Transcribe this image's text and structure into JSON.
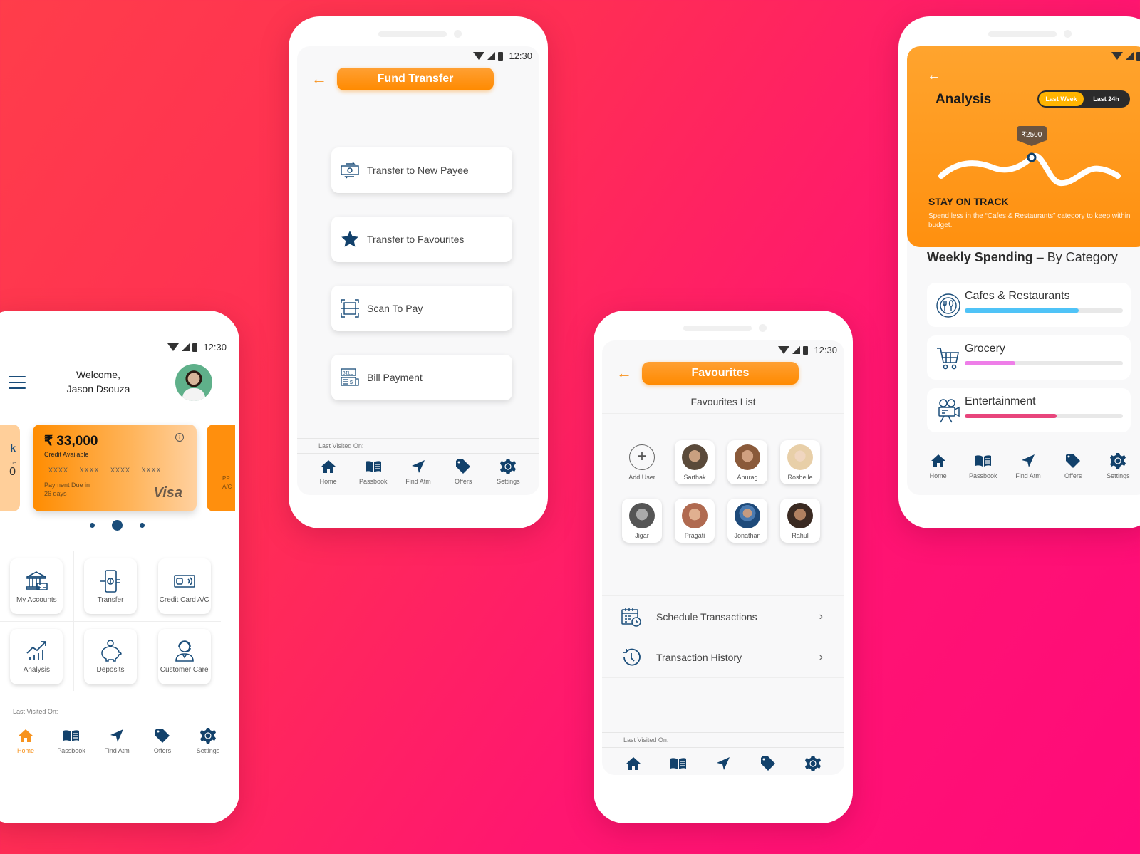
{
  "colors": {
    "accent": "#ff8c00",
    "navy": "#12416b",
    "bg_start": "#ff3d4a",
    "bg_end": "#ff0a7a"
  },
  "status_bar": {
    "time": "12:30",
    "icons": [
      "wifi-icon",
      "signal-icon",
      "battery-icon"
    ]
  },
  "bottom_nav": {
    "items": [
      {
        "label": "Home",
        "icon": "home-icon"
      },
      {
        "label": "Passbook",
        "icon": "passbook-icon"
      },
      {
        "label": "Find Atm",
        "icon": "navigation-arrow-icon"
      },
      {
        "label": "Offers",
        "icon": "tag-icon"
      },
      {
        "label": "Settings",
        "icon": "gear-icon"
      }
    ]
  },
  "last_visited_label": "Last Visited On:",
  "home": {
    "welcome_line1": "Welcome,",
    "welcome_line2": "Jason Dsouza",
    "active_nav": "Home",
    "card_left": {
      "fragment1": "k",
      "fragment2": "ce",
      "fragment3": "0"
    },
    "card": {
      "amount": "₹ 33,000",
      "amount_label": "Credit Available",
      "number": "XXXX XXXX XXXX XXXX",
      "due_line1": "Payment Due in",
      "due_line2": "26 days",
      "brand": "Visa",
      "info_icon": "info-icon"
    },
    "card_right": {
      "line1": "PP",
      "line2": "A/C"
    },
    "carousel": {
      "count": 3,
      "active": 2
    },
    "tiles": [
      {
        "label": "My Accounts",
        "icon": "bank-icon"
      },
      {
        "label": "Transfer",
        "icon": "phone-transfer-icon"
      },
      {
        "label": "Credit Card A/C",
        "icon": "credit-card-icon"
      },
      {
        "label": "Analysis",
        "icon": "growth-chart-icon"
      },
      {
        "label": "Deposits",
        "icon": "piggy-bank-icon"
      },
      {
        "label": "Customer Care",
        "icon": "support-agent-icon"
      }
    ]
  },
  "fund_transfer": {
    "title": "Fund Transfer",
    "options": [
      {
        "label": "Transfer to New Payee",
        "icon": "cash-exchange-icon"
      },
      {
        "label": "Transfer to Favourites",
        "icon": "star-icon"
      },
      {
        "label": "Scan To Pay",
        "icon": "scan-icon"
      },
      {
        "label": "Bill Payment",
        "icon": "bill-icon"
      }
    ]
  },
  "favourites": {
    "title": "Favourites",
    "subtitle": "Favourites List",
    "add_user_label": "Add User",
    "users": [
      {
        "name": "Sarthak",
        "color": "#5a4a3a"
      },
      {
        "name": "Anurag",
        "color": "#8a5a3a"
      },
      {
        "name": "Roshelle",
        "color": "#e8cfa8"
      },
      {
        "name": "Jigar",
        "color": "#666666"
      },
      {
        "name": "Pragati",
        "color": "#b06a50"
      },
      {
        "name": "Jonathan",
        "color": "#1e4a7a"
      },
      {
        "name": "Rahul",
        "color": "#3a2a22"
      }
    ],
    "actions": [
      {
        "label": "Schedule Transactions",
        "icon": "calendar-clock-icon"
      },
      {
        "label": "Transaction History",
        "icon": "history-icon"
      }
    ]
  },
  "analysis": {
    "title": "Analysis",
    "toggle": {
      "options": [
        "Last Week",
        "Last 24h"
      ],
      "selected": "Last Week"
    },
    "tooltip_value": "₹2500",
    "heading": "STAY ON TRACK",
    "message": "Spend less in the “Cafes & Restaurants” category to keep within budget.",
    "weekly_title_bold": "Weekly Spending",
    "weekly_title_rest": " – By Category",
    "categories": [
      {
        "name": "Cafes & Restaurants",
        "icon": "cutlery-icon",
        "progress": 0.72,
        "color": "#4fc3f7"
      },
      {
        "name": "Grocery",
        "icon": "cart-icon",
        "progress": 0.32,
        "color": "#ee7ee8"
      },
      {
        "name": "Entertainment",
        "icon": "movie-camera-icon",
        "progress": 0.58,
        "color": "#e8457c"
      }
    ]
  }
}
